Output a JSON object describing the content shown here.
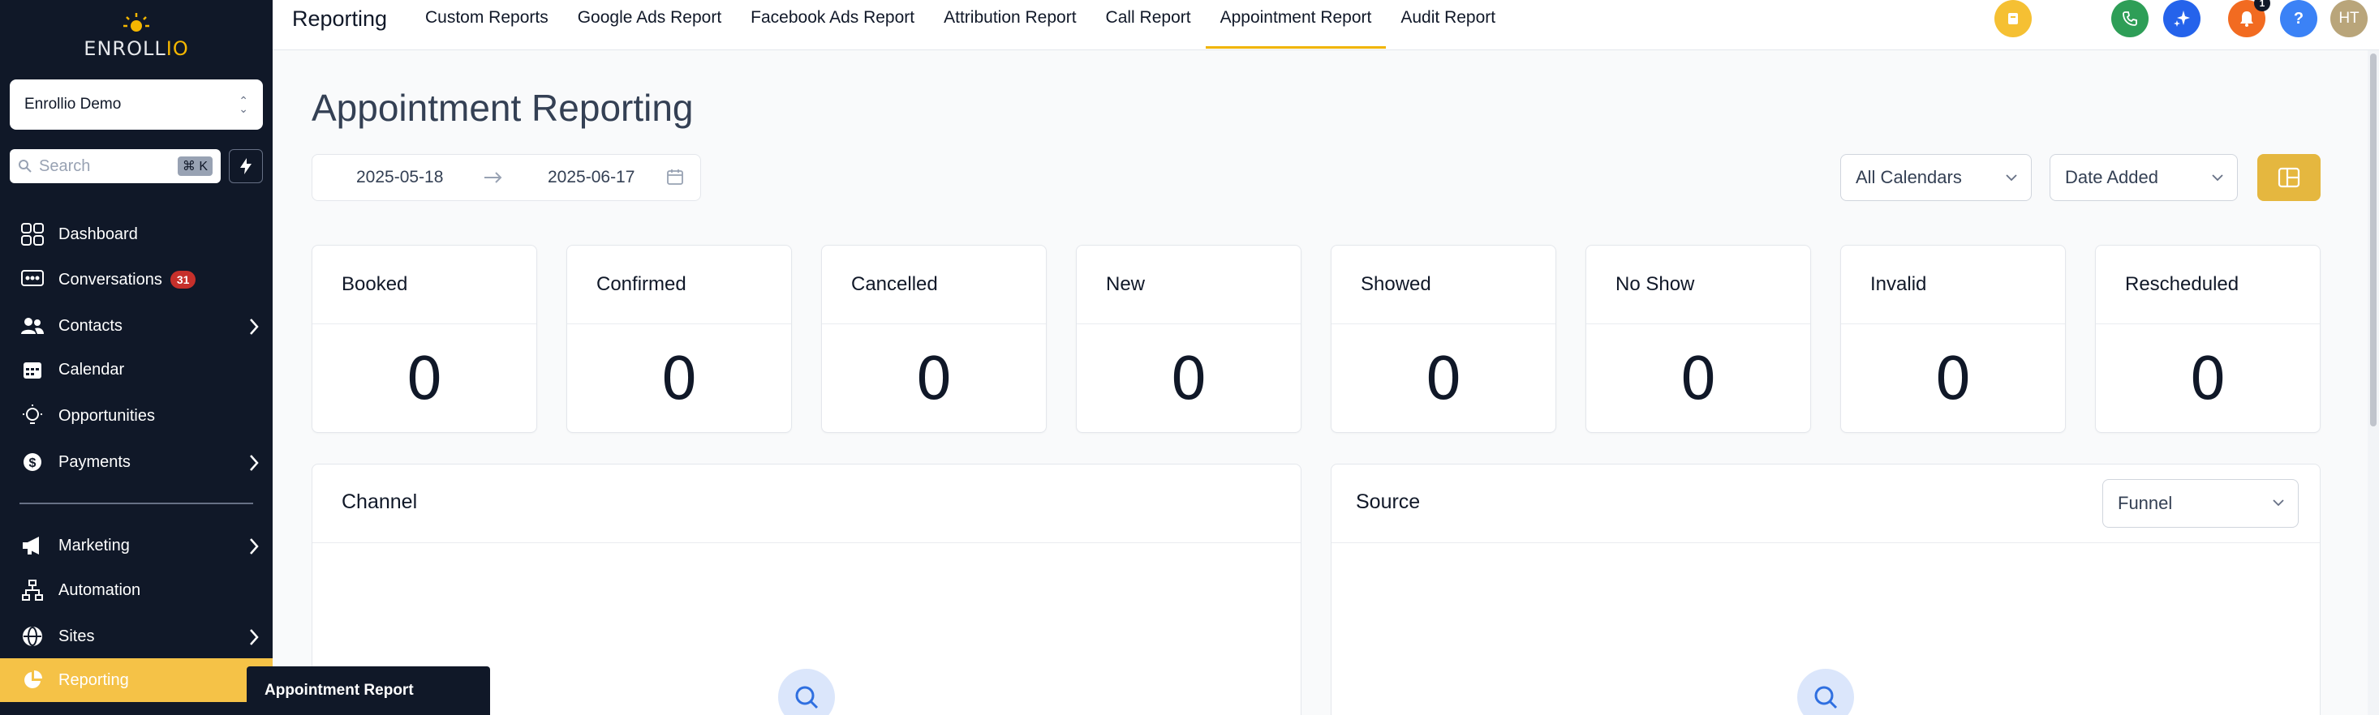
{
  "sidebar": {
    "logo_text_main": "ENROLL",
    "logo_text_accent": "IO",
    "account": "Enrollio Demo",
    "search_placeholder": "Search",
    "search_shortcut": "⌘ K",
    "items": [
      {
        "label": "Dashboard",
        "icon": "dashboard-icon"
      },
      {
        "label": "Conversations",
        "icon": "chat-icon",
        "badge": "31"
      },
      {
        "label": "Contacts",
        "icon": "users-icon",
        "expandable": true
      },
      {
        "label": "Calendar",
        "icon": "calendar-icon"
      },
      {
        "label": "Opportunities",
        "icon": "lightbulb-icon"
      },
      {
        "label": "Payments",
        "icon": "dollar-icon",
        "expandable": true
      },
      {
        "label": "Marketing",
        "icon": "megaphone-icon",
        "expandable": true
      },
      {
        "label": "Automation",
        "icon": "workflow-icon"
      },
      {
        "label": "Sites",
        "icon": "globe-icon",
        "expandable": true
      },
      {
        "label": "Reporting",
        "icon": "pie-chart-icon",
        "active": true
      }
    ],
    "tooltip": "Appointment Report"
  },
  "header": {
    "title": "Reporting",
    "tabs": [
      "Custom Reports",
      "Google Ads Report",
      "Facebook Ads Report",
      "Attribution Report",
      "Call Report",
      "Appointment Report",
      "Audit Report"
    ],
    "active_tab": "Appointment Report",
    "notification_count": "1",
    "help": "?",
    "avatar": "HT",
    "colors": {
      "accent": "#f0b400",
      "phone": "#2e9e57",
      "ai": "#2563eb",
      "notify": "#f26b21",
      "help": "#3b82f6",
      "avatar": "#b9a57a"
    }
  },
  "main": {
    "page_title": "Appointment Reporting",
    "date_start": "2025-05-18",
    "date_end": "2025-06-17",
    "calendar_filter": "All Calendars",
    "date_filter": "Date Added",
    "stats": [
      {
        "label": "Booked",
        "value": "0"
      },
      {
        "label": "Confirmed",
        "value": "0"
      },
      {
        "label": "Cancelled",
        "value": "0"
      },
      {
        "label": "New",
        "value": "0"
      },
      {
        "label": "Showed",
        "value": "0"
      },
      {
        "label": "No Show",
        "value": "0"
      },
      {
        "label": "Invalid",
        "value": "0"
      },
      {
        "label": "Rescheduled",
        "value": "0"
      }
    ],
    "channel_title": "Channel",
    "source_title": "Source",
    "source_filter": "Funnel"
  }
}
